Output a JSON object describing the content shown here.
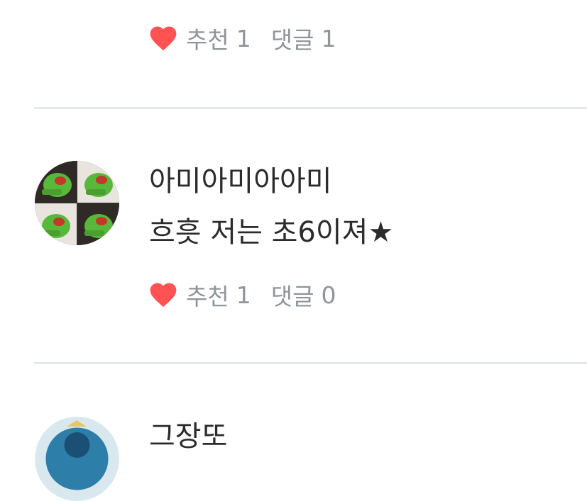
{
  "colors": {
    "heart": "#ff5252",
    "meta_text": "#8f9599",
    "divider": "#e6eaea",
    "body_text": "#2b2b2b"
  },
  "comments": [
    {
      "footer": {
        "heart_icon": "heart-icon",
        "like_label": "추천",
        "like_count": "1",
        "reply_label": "댓글",
        "reply_count": "1"
      }
    },
    {
      "username": "아미아미아아미",
      "text": "흐흣 저는 초6이져★",
      "avatar_icon": "frog-avatar",
      "footer": {
        "heart_icon": "heart-icon",
        "like_label": "추천",
        "like_count": "1",
        "reply_label": "댓글",
        "reply_count": "0"
      }
    },
    {
      "username": "그장또",
      "avatar_icon": "blue-circle-avatar"
    }
  ]
}
